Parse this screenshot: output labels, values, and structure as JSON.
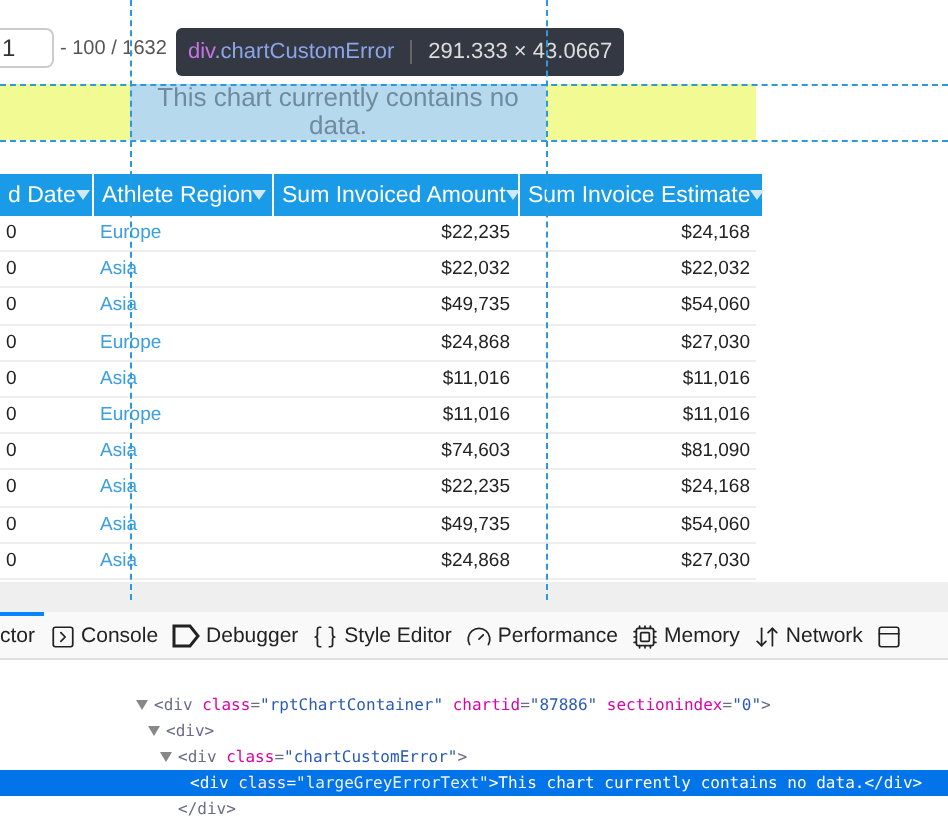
{
  "pager": {
    "value": "1",
    "range_text": "- 100 / 1632"
  },
  "tooltip": {
    "selector_tag": "div",
    "selector_class": ".chartCustomError",
    "size": "291.333 × 43.0667"
  },
  "chart_error": {
    "text": "This chart currently contains no data."
  },
  "table": {
    "columns": [
      "d Date",
      "Athlete Region",
      "Sum Invoiced Amount",
      "Sum Invoice Estimate"
    ],
    "rows": [
      [
        "0",
        "Europe",
        "$22,235",
        "$24,168"
      ],
      [
        "0",
        "Asia",
        "$22,032",
        "$22,032"
      ],
      [
        "0",
        "Asia",
        "$49,735",
        "$54,060"
      ],
      [
        "0",
        "Europe",
        "$24,868",
        "$27,030"
      ],
      [
        "0",
        "Asia",
        "$11,016",
        "$11,016"
      ],
      [
        "0",
        "Europe",
        "$11,016",
        "$11,016"
      ],
      [
        "0",
        "Asia",
        "$74,603",
        "$81,090"
      ],
      [
        "0",
        "Asia",
        "$22,235",
        "$24,168"
      ],
      [
        "0",
        "Asia",
        "$49,735",
        "$54,060"
      ],
      [
        "0",
        "Asia",
        "$24,868",
        "$27,030"
      ]
    ]
  },
  "devtools": {
    "tabs": [
      {
        "kind": "inspector",
        "label": "ctor",
        "selected": true
      },
      {
        "kind": "console",
        "label": "Console",
        "selected": false
      },
      {
        "kind": "debugger",
        "label": "Debugger",
        "selected": false
      },
      {
        "kind": "style",
        "label": "Style Editor",
        "selected": false
      },
      {
        "kind": "performance",
        "label": "Performance",
        "selected": false
      },
      {
        "kind": "memory",
        "label": "Memory",
        "selected": false
      },
      {
        "kind": "network",
        "label": "Network",
        "selected": false
      },
      {
        "kind": "storage",
        "selected": false
      }
    ],
    "markup": [
      {
        "expanded": true,
        "selected": false,
        "segments": [
          {
            "kind": "tag",
            "text": "<div "
          },
          {
            "kind": "attr",
            "text": "class"
          },
          {
            "kind": "tag",
            "text": "="
          },
          {
            "kind": "value",
            "text": "\"rptChartContainer\""
          },
          {
            "kind": "attr",
            "text": " chartid"
          },
          {
            "kind": "tag",
            "text": "="
          },
          {
            "kind": "value",
            "text": "\"87886\""
          },
          {
            "kind": "attr",
            "text": " sectionindex"
          },
          {
            "kind": "tag",
            "text": "="
          },
          {
            "kind": "value",
            "text": "\"0\""
          },
          {
            "kind": "tag",
            "text": ">"
          }
        ],
        "children": [
          {
            "expanded": true,
            "selected": false,
            "segments": [
              {
                "kind": "tag",
                "text": "<div>"
              }
            ],
            "children": [
              {
                "expanded": true,
                "selected": false,
                "segments": [
                  {
                    "kind": "tag",
                    "text": "<div "
                  },
                  {
                    "kind": "attr",
                    "text": "class"
                  },
                  {
                    "kind": "tag",
                    "text": "="
                  },
                  {
                    "kind": "value",
                    "text": "\"chartCustomError\""
                  },
                  {
                    "kind": "tag",
                    "text": ">"
                  }
                ],
                "closing": "</div>",
                "children": [
                  {
                    "expanded": false,
                    "selected": true,
                    "segments": [
                      {
                        "kind": "tag",
                        "text": "<div "
                      },
                      {
                        "kind": "attr",
                        "text": "class"
                      },
                      {
                        "kind": "tag",
                        "text": "="
                      },
                      {
                        "kind": "value",
                        "text": "\"largeGreyErrorText\""
                      },
                      {
                        "kind": "tag",
                        "text": ">"
                      },
                      {
                        "kind": "text",
                        "text": "This chart currently contains no data."
                      },
                      {
                        "kind": "tag",
                        "text": "</div>"
                      }
                    ]
                  }
                ]
              }
            ]
          }
        ]
      }
    ]
  }
}
